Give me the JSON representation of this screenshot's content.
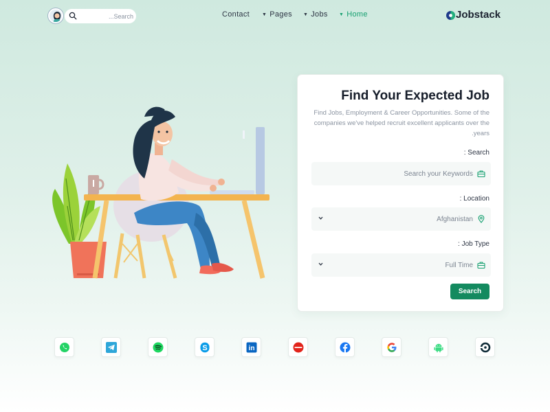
{
  "header": {
    "search": {
      "placeholder": "...Search"
    },
    "nav": [
      {
        "label": "Contact"
      },
      {
        "label": "Pages"
      },
      {
        "label": "Jobs"
      },
      {
        "label": "Home"
      }
    ],
    "logo": {
      "text": "Jobstack"
    },
    "active_color": "#16a070"
  },
  "card": {
    "title": "Find Your Expected Job",
    "description": "Find Jobs, Employment & Career Opportunities. Some of the companies we've helped recruit excellent applicants over the years.",
    "fields": {
      "search": {
        "label": ": Search",
        "placeholder": "Search your Keywords",
        "icon": "briefcase-icon"
      },
      "location": {
        "label": ": Location",
        "value": "Afghanistan",
        "icon": "map-pin-icon"
      },
      "job_type": {
        "label": ": Job Type",
        "value": "Full Time",
        "icon": "briefcase-icon"
      }
    },
    "button": {
      "label": "Search"
    },
    "accent": "#138a5f"
  },
  "partners": [
    {
      "name": "whatsapp-icon"
    },
    {
      "name": "telegram-icon"
    },
    {
      "name": "spotify-icon"
    },
    {
      "name": "skype-icon"
    },
    {
      "name": "linkedin-icon"
    },
    {
      "name": "lenovo-icon"
    },
    {
      "name": "facebook-icon"
    },
    {
      "name": "google-icon"
    },
    {
      "name": "android-icon"
    },
    {
      "name": "circle-logo-icon"
    }
  ]
}
